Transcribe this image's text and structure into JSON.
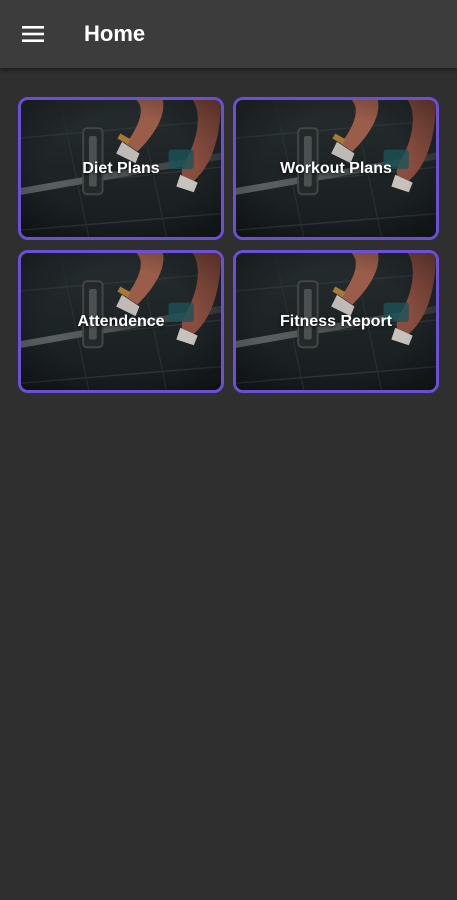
{
  "app_bar": {
    "title": "Home",
    "menu_icon": "hamburger-menu-icon"
  },
  "tiles": [
    {
      "label": "Diet Plans"
    },
    {
      "label": "Workout Plans"
    },
    {
      "label": "Attendence"
    },
    {
      "label": "Fitness Report"
    }
  ],
  "colors": {
    "background": "#2f2f2f",
    "app_bar": "#3c3c3c",
    "tile_border": "#6b4fd6",
    "text": "#ffffff"
  }
}
